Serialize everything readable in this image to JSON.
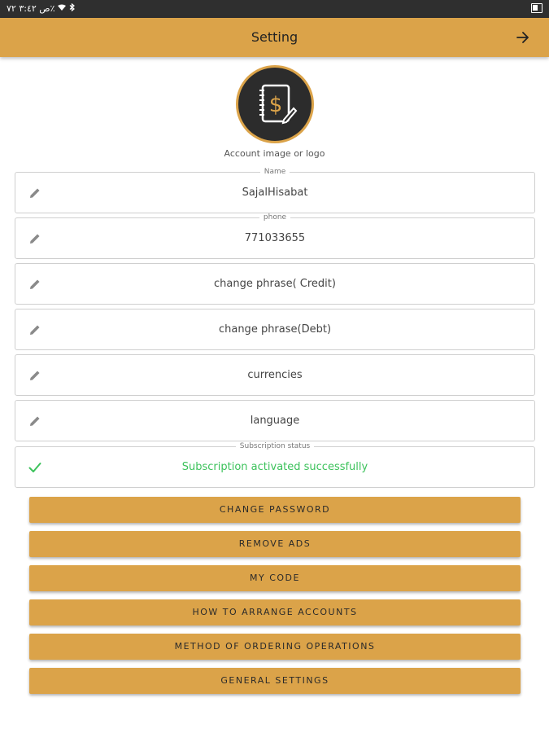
{
  "status_bar": {
    "left_text": "ص ٣:٤٢ ٧٢٪",
    "icons": [
      "wifi-icon",
      "bluetooth-icon",
      "battery-icon",
      "photo-icon"
    ]
  },
  "app_bar": {
    "title": "Setting",
    "back_icon": "arrow-right-icon"
  },
  "logo": {
    "caption": "Account image or logo",
    "icon": "notebook-dollar-pen-icon"
  },
  "fields": [
    {
      "legend": "Name",
      "value": "SajalHisabat",
      "icon": "pencil-icon"
    },
    {
      "legend": "phone",
      "value": "771033655",
      "icon": "pencil-icon"
    },
    {
      "legend": "",
      "value": "change phrase( Credit)",
      "icon": "pencil-icon"
    },
    {
      "legend": "",
      "value": "change phrase(Debt)",
      "icon": "pencil-icon"
    },
    {
      "legend": "",
      "value": "currencies",
      "icon": "pencil-icon"
    },
    {
      "legend": "",
      "value": "language",
      "icon": "pencil-icon"
    },
    {
      "legend": "Subscription status",
      "value": "Subscription activated successfully",
      "icon": "check-icon"
    }
  ],
  "buttons": [
    "CHANGE PASSWORD",
    "REMOVE ADS",
    "MY CODE",
    "HOW TO ARRANGE ACCOUNTS",
    "METHOD OF ORDERING OPERATIONS",
    "GENERAL SETTINGS"
  ],
  "colors": {
    "accent": "#dba349",
    "success": "#3cc25b",
    "status_bar": "#2f2f2f"
  }
}
